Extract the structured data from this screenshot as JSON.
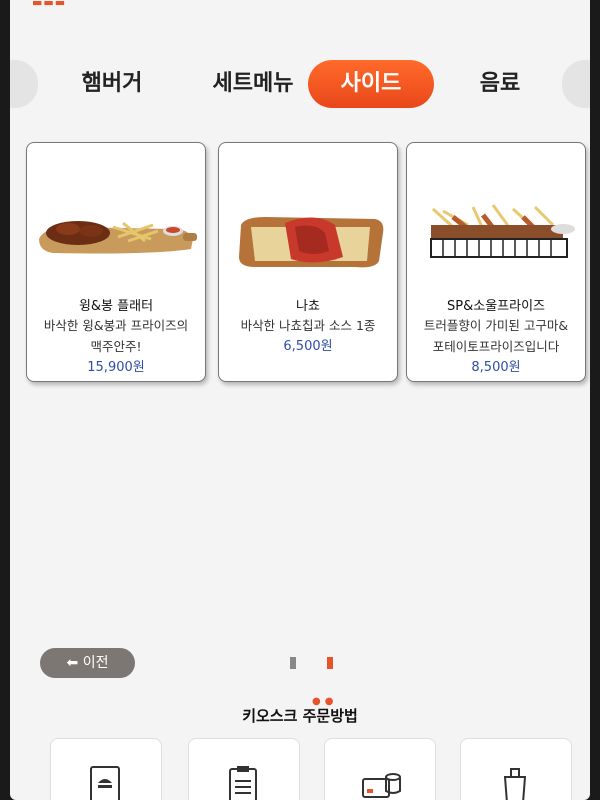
{
  "tabs": [
    {
      "label": "햄버거",
      "active": false
    },
    {
      "label": "세트메뉴",
      "active": false
    },
    {
      "label": "사이드",
      "active": true
    },
    {
      "label": "음료",
      "active": false
    }
  ],
  "products": [
    {
      "name": "윙&봉 플래터",
      "desc_line1": "바삭한 윙&봉과 프라이즈의",
      "desc_line2": "맥주안주!",
      "price": "15,900원"
    },
    {
      "name": "나쵸",
      "desc_line1": "바삭한 나쵸칩과 소스 1종",
      "desc_line2": "",
      "price": "6,500원"
    },
    {
      "name": "SP&소울프라이즈",
      "desc_line1": "트러플향이 가미된 고구마&",
      "desc_line2": "포테이토프라이즈입니다",
      "price": "8,500원"
    }
  ],
  "back_button": {
    "label": "이전",
    "icon": "arrow-left-icon"
  },
  "pager": {
    "current": 2,
    "total": 2
  },
  "guide": {
    "title": "키오스크 주문방법"
  },
  "colors": {
    "accent": "#e9471a",
    "price": "#2e4fa3"
  }
}
